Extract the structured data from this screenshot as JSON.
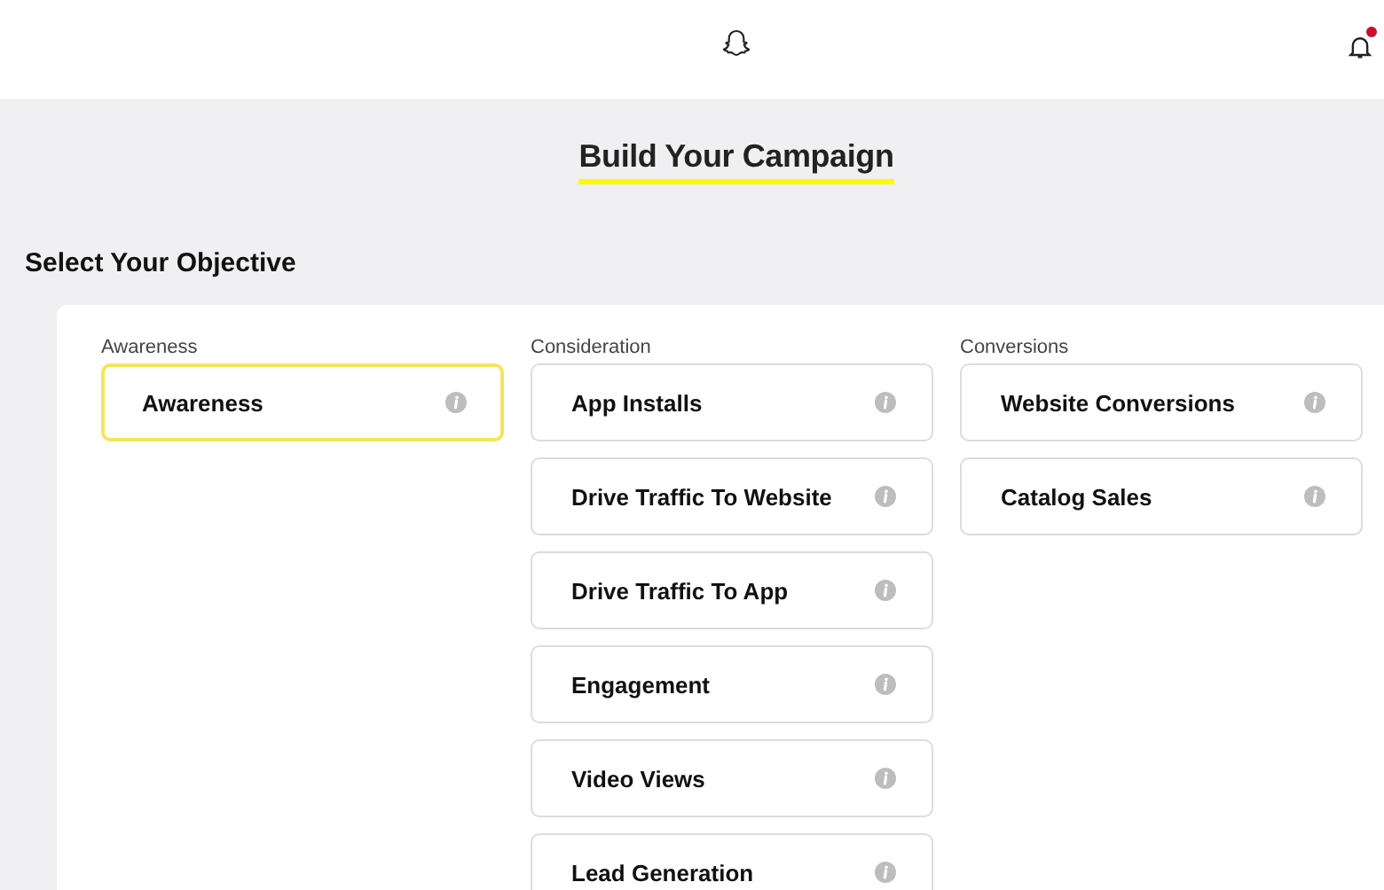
{
  "header": {
    "notification_badge": true
  },
  "title": "Build Your Campaign",
  "section_title": "Select Your Objective",
  "groups": [
    {
      "label": "Awareness",
      "options": [
        {
          "label": "Awareness",
          "selected": true
        }
      ]
    },
    {
      "label": "Consideration",
      "options": [
        {
          "label": "App Installs",
          "selected": false
        },
        {
          "label": "Drive Traffic To Website",
          "selected": false
        },
        {
          "label": "Drive Traffic To App",
          "selected": false
        },
        {
          "label": "Engagement",
          "selected": false
        },
        {
          "label": "Video Views",
          "selected": false
        },
        {
          "label": "Lead Generation",
          "selected": false
        }
      ]
    },
    {
      "label": "Conversions",
      "options": [
        {
          "label": "Website Conversions",
          "selected": false
        },
        {
          "label": "Catalog Sales",
          "selected": false
        }
      ]
    }
  ]
}
